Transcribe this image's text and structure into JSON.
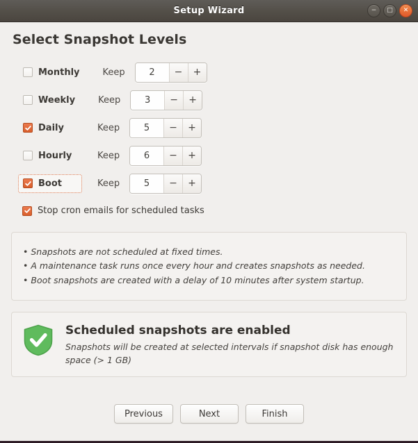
{
  "window": {
    "title": "Setup Wizard",
    "controls": [
      {
        "name": "minimize",
        "glyph": "−"
      },
      {
        "name": "maximize",
        "glyph": "□"
      },
      {
        "name": "close",
        "glyph": "✕"
      }
    ]
  },
  "page": {
    "title": "Select Snapshot Levels"
  },
  "levels": [
    {
      "label": "Monthly",
      "checked": false,
      "focused": false,
      "keep_label": "Keep",
      "value": "2",
      "minus": "−",
      "plus": "+"
    },
    {
      "label": "Weekly",
      "checked": false,
      "focused": false,
      "keep_label": "Keep",
      "value": "3",
      "minus": "−",
      "plus": "+"
    },
    {
      "label": "Daily",
      "checked": true,
      "focused": false,
      "keep_label": "Keep",
      "value": "5",
      "minus": "−",
      "plus": "+"
    },
    {
      "label": "Hourly",
      "checked": false,
      "focused": false,
      "keep_label": "Keep",
      "value": "6",
      "minus": "−",
      "plus": "+"
    },
    {
      "label": "Boot",
      "checked": true,
      "focused": true,
      "keep_label": "Keep",
      "value": "5",
      "minus": "−",
      "plus": "+"
    }
  ],
  "cron": {
    "label": "Stop cron emails for scheduled tasks",
    "checked": true
  },
  "notes": {
    "bullet": "•",
    "lines": [
      "Snapshots are not scheduled at fixed times.",
      "A maintenance task runs once every hour and creates snapshots as needed.",
      "Boot snapshots are created with a delay of 10 minutes after system startup."
    ]
  },
  "status": {
    "icon": "shield-check-icon",
    "title": "Scheduled snapshots are enabled",
    "description": "Snapshots will be created at selected intervals if snapshot disk has enough space (> 1 GB)"
  },
  "footer": {
    "previous": "Previous",
    "next": "Next",
    "finish": "Finish"
  },
  "colors": {
    "accent_orange": "#d95f2c",
    "status_green": "#5cb85c",
    "titlebar": "#544f49",
    "background": "#f1efed"
  }
}
